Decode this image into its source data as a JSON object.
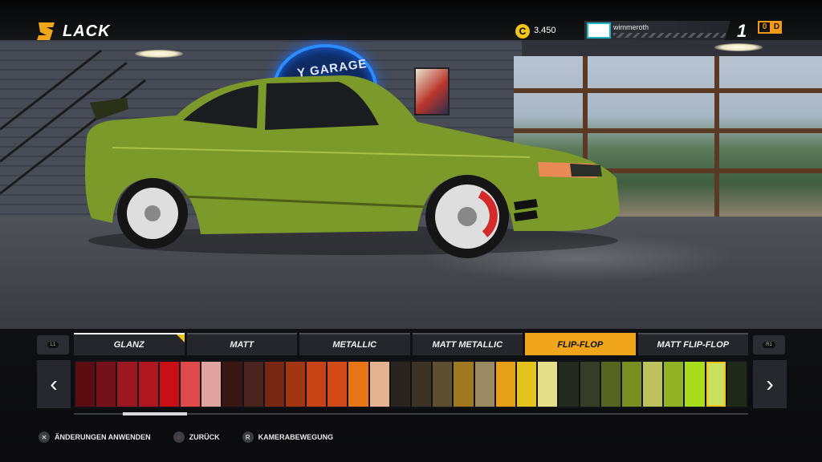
{
  "header": {
    "title": "LACK",
    "coins": "3.450",
    "coin_symbol": "C",
    "player_name": "wimmeroth",
    "player_level": "1",
    "badge_left": "0",
    "badge_right": "D"
  },
  "scene": {
    "neon_sign_text": "Y GARAGE"
  },
  "paint_types": {
    "tabs": [
      {
        "label": "GLANZ"
      },
      {
        "label": "MATT"
      },
      {
        "label": "METALLIC"
      },
      {
        "label": "MATT METALLIC"
      },
      {
        "label": "FLIP-FLOP"
      },
      {
        "label": "MATT FLIP-FLOP"
      }
    ],
    "active_tab": "FLIP-FLOP",
    "left_shoulder": "L1",
    "right_shoulder": "R1"
  },
  "colors": {
    "swatches": [
      "#5b0d12",
      "#74111a",
      "#9b1820",
      "#b0161f",
      "#c90f16",
      "#e04a4a",
      "#e0a3a0",
      "#3a1614",
      "#4b2420",
      "#7a2614",
      "#a33612",
      "#c74316",
      "#d24a17",
      "#e87516",
      "#e6b390",
      "#2a2420",
      "#3d3324",
      "#5e4f33",
      "#a0781f",
      "#9a8b62",
      "#e6a01a",
      "#e3c41f",
      "#e6df8a",
      "#232a1d",
      "#353d28",
      "#56641f",
      "#7a8f22",
      "#bdc25e",
      "#93b327",
      "#a8dc1c",
      "#cce060",
      "#1f2a1b"
    ],
    "selected_index": 30,
    "car_paint": "#7c9a2a"
  },
  "scroll": {
    "position": 0.08
  },
  "hints": [
    {
      "button": "✕",
      "label": "ÄNDERUNGEN ANWENDEN"
    },
    {
      "button": "○",
      "label": "ZURÜCK"
    },
    {
      "button": "R",
      "label": "KAMERABEWEGUNG"
    }
  ]
}
